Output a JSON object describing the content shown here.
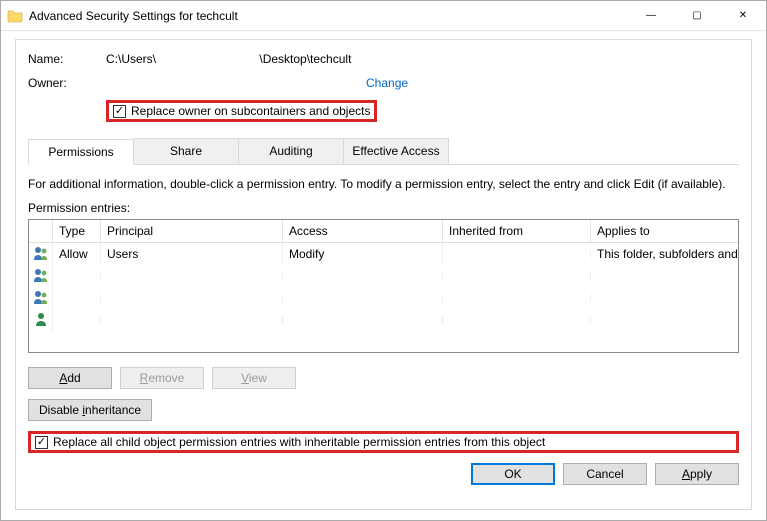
{
  "window": {
    "title": "Advanced Security Settings for techcult"
  },
  "header": {
    "name_label": "Name:",
    "name_value": "C:\\Users\\                               \\Desktop\\techcult",
    "owner_label": "Owner:",
    "owner_value": "",
    "change_link": "Change",
    "replace_owner_label": "Replace owner on subcontainers and objects"
  },
  "tabs": {
    "items": [
      "Permissions",
      "Share",
      "Auditing",
      "Effective Access"
    ],
    "active_index": 0
  },
  "info_text": "For additional information, double-click a permission entry. To modify a permission entry, select the entry and click Edit (if available).",
  "perm_label": "Permission entries:",
  "perm_headers": {
    "type": "Type",
    "principal": "Principal",
    "access": "Access",
    "inherited": "Inherited from",
    "applies": "Applies to"
  },
  "perm_rows": [
    {
      "icon": "users",
      "type": "Allow",
      "principal": "Users",
      "access": "Modify",
      "inherited": "",
      "applies": "This folder, subfolders and files"
    },
    {
      "icon": "users",
      "type": "",
      "principal": "",
      "access": "",
      "inherited": "",
      "applies": ""
    },
    {
      "icon": "users",
      "type": "",
      "principal": "",
      "access": "",
      "inherited": "",
      "applies": ""
    },
    {
      "icon": "user",
      "type": "",
      "principal": "",
      "access": "",
      "inherited": "",
      "applies": ""
    }
  ],
  "buttons": {
    "add": "Add",
    "remove": "Remove",
    "view": "View",
    "disable_inheritance": "Disable inheritance",
    "replace_child_label": "Replace all child object permission entries with inheritable permission entries from this object",
    "ok": "OK",
    "cancel": "Cancel",
    "apply": "Apply"
  }
}
